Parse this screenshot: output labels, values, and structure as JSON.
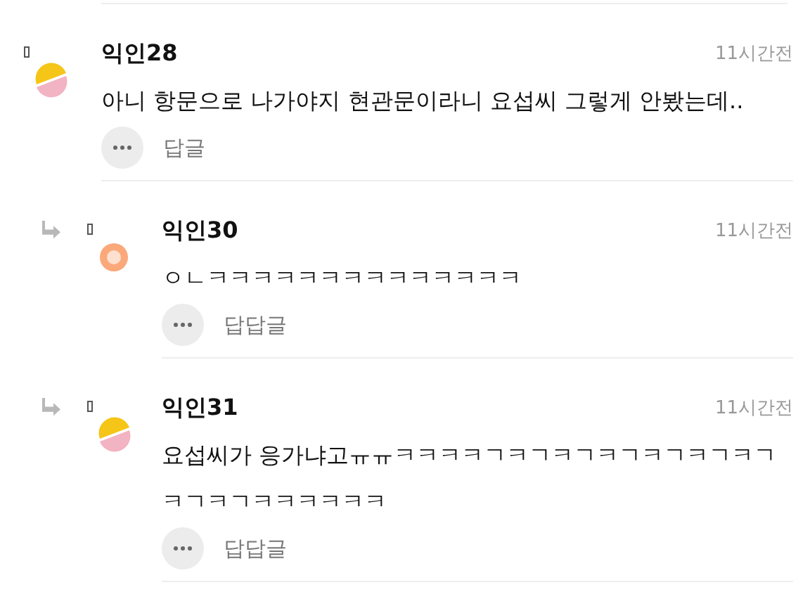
{
  "comments": [
    {
      "author": "익인28",
      "time": "11시간전",
      "body": "아니 항문으로 나가야지 현관문이라니 요섭씨 그렇게 안봤는데..",
      "reply_label": "답글",
      "is_reply": false,
      "kind": "split"
    },
    {
      "author": "익인30",
      "time": "11시간전",
      "body": "ㅇㄴㅋㅋㅋㅋㅋㅋㅋㅋㅋㅋㅋㅋㅋㅋ",
      "reply_label": "답답글",
      "is_reply": true,
      "kind": "dot"
    },
    {
      "author": "익인31",
      "time": "11시간전",
      "body": "요섭씨가 응가냐고ㅠㅠㅋㅋㅋㅋㄱㅋㄱㅋㄱㅋㄱㅋㄱㅋㄱㅋㄱㅋㄱㅋㄱㅋㅋㅋㅋㅋㅋ",
      "reply_label": "답답글",
      "is_reply": true,
      "kind": "split"
    }
  ]
}
